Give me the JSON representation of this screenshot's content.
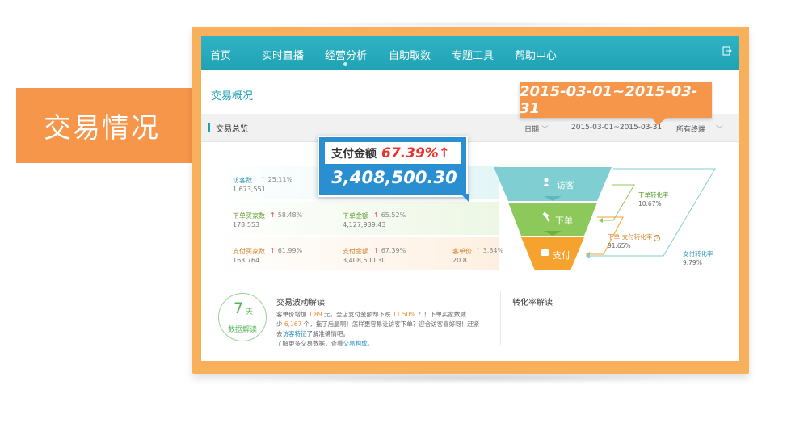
{
  "banner": {
    "label": "交易情况"
  },
  "nav": {
    "items": [
      "首页",
      "实时直播",
      "经营分析",
      "自助取数",
      "专题工具",
      "帮助中心"
    ],
    "active": "经营分析",
    "exit_icon": "exit-icon"
  },
  "section": {
    "title": "交易概况"
  },
  "toolbar": {
    "title": "交易总览",
    "date_label": "日期",
    "date_range": "2015-03-01~2015-03-31",
    "terminal": "所有终端"
  },
  "callout_date": "2015-03-01~2015-03-31",
  "callout_pay": {
    "label": "支付金额",
    "pct": "67.39%↑",
    "value": "3,408,500.30"
  },
  "metrics": {
    "visitors": {
      "label": "访客数",
      "pct": "25.11%",
      "value": "1,673,551"
    },
    "order_buyers": {
      "label": "下单买家数",
      "pct": "58.48%",
      "value": "178,553"
    },
    "order_amount": {
      "label": "下单金额",
      "pct": "65.52%",
      "value": "4,127,939.43"
    },
    "pay_buyers": {
      "label": "支付买家数",
      "pct": "61.99%",
      "value": "163,764"
    },
    "pay_amount": {
      "label": "支付金额",
      "pct": "67.39%",
      "value": "3,408,500.30"
    },
    "unit_price": {
      "label": "客单价",
      "pct": "3.34%",
      "value": "20.81"
    }
  },
  "funnel": {
    "visitor": "访客",
    "order": "下单",
    "pay": "支付",
    "colors": {
      "visitor": "#7fcfd2",
      "order": "#8cc95a",
      "pay": "#f6a22f"
    }
  },
  "conversion": {
    "order_rate_label": "下单转化率",
    "order_rate": "10.67%",
    "order_pay_label": "下单-支付转化率",
    "order_pay_rate": "91.65%",
    "pay_rate_label": "支付转化率",
    "pay_rate": "9.79%"
  },
  "analysis": {
    "badge_number": "7",
    "badge_unit": "天",
    "badge_text": "数据解读",
    "title": "交易波动解读",
    "line1_a": "客单价增加 ",
    "line1_b": "1.89",
    "line1_c": " 元，全店支付金额却下跌 ",
    "line1_d": "11.50%",
    "line1_e": " ？！下单买家数减",
    "line2_a": "少 ",
    "line2_b": "6,167",
    "line2_c": " 个，拖了后腿啊！怎样更容易让访客下单？迎合访客喜好呀！赶紧",
    "line3_a": "去",
    "line3_b": "访客特征",
    "line3_c": "了解准确情吧。",
    "line4_a": "了解更多交易数据，查看",
    "line4_b": "交易构成",
    "line4_c": "。"
  },
  "conversion_section": {
    "title": "转化率解读"
  }
}
